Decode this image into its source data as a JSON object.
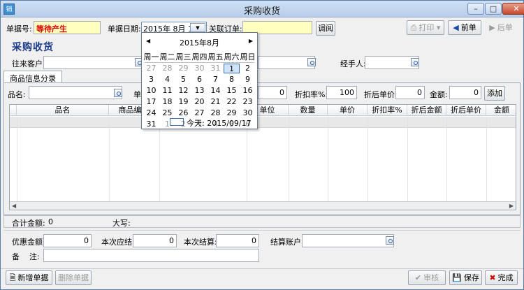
{
  "window": {
    "title": "采购收货",
    "icon": "app-icon",
    "icon_text": "销"
  },
  "header": {
    "doc_no_label": "单据号:",
    "doc_no_value": "等待产生",
    "doc_date_label": "单据日期:",
    "doc_date_value": "2015年  8月  1日",
    "linked_order_label": "关联订单:",
    "linked_order_value": "",
    "fetch_button": "调阅",
    "print_button": "打印",
    "prev_button": "前单",
    "next_button": "后单"
  },
  "form": {
    "section_title": "采购收货",
    "customer_label": "往来客户:",
    "customer_value": "",
    "handler_label": "经手人:",
    "handler_value": ""
  },
  "tab": {
    "label": "商品信息分录"
  },
  "entry_row": {
    "product_label": "品名:",
    "product_value": "",
    "unit_label": "单",
    "qty_value": "0",
    "discount_label": "折扣率%:",
    "discount_value": "100",
    "disc_price_label": "折后单价:",
    "disc_price_value": "0",
    "amount_label": "金额:",
    "amount_value": "0",
    "add_button": "添加"
  },
  "grid": {
    "columns": [
      "品名",
      "商品编号",
      "单位",
      "数量",
      "单价",
      "折扣率%",
      "折后金额",
      "折后单价",
      "金额"
    ]
  },
  "totals": {
    "total_label": "合计金额:",
    "total_value": "0",
    "uppercase_label": "大写:",
    "uppercase_value": ""
  },
  "settlement": {
    "discount_amount_label": "优惠金额:",
    "discount_amount_value": "0",
    "due_label": "本次应结:",
    "due_value": "0",
    "settled_label": "本次结算:",
    "settled_value": "0",
    "account_label": "结算账户:",
    "account_value": "",
    "remark_label": "备    注:",
    "remark_value": ""
  },
  "footer": {
    "new_doc_button": "新增单据",
    "delete_doc_button": "删除单据",
    "audit_button": "审核",
    "save_button": "保存",
    "finish_button": "完成"
  },
  "calendar": {
    "month_title": "2015年8月",
    "weekdays": [
      "周一",
      "周二",
      "周三",
      "周四",
      "周五",
      "周六",
      "周日"
    ],
    "weeks": [
      [
        "27",
        "28",
        "29",
        "30",
        "31",
        "1",
        "2"
      ],
      [
        "3",
        "4",
        "5",
        "6",
        "7",
        "8",
        "9"
      ],
      [
        "10",
        "11",
        "12",
        "13",
        "14",
        "15",
        "16"
      ],
      [
        "17",
        "18",
        "19",
        "20",
        "21",
        "22",
        "23"
      ],
      [
        "24",
        "25",
        "26",
        "27",
        "28",
        "29",
        "30"
      ],
      [
        "31",
        "1",
        "2",
        "3",
        "4",
        "5",
        "6"
      ]
    ],
    "selected_day": "1",
    "today_text": "今天: 2015/09/17"
  },
  "colors": {
    "accent": "#1a3a8a",
    "status_red": "#e00000",
    "selected_bg": "#cfe3fa"
  }
}
